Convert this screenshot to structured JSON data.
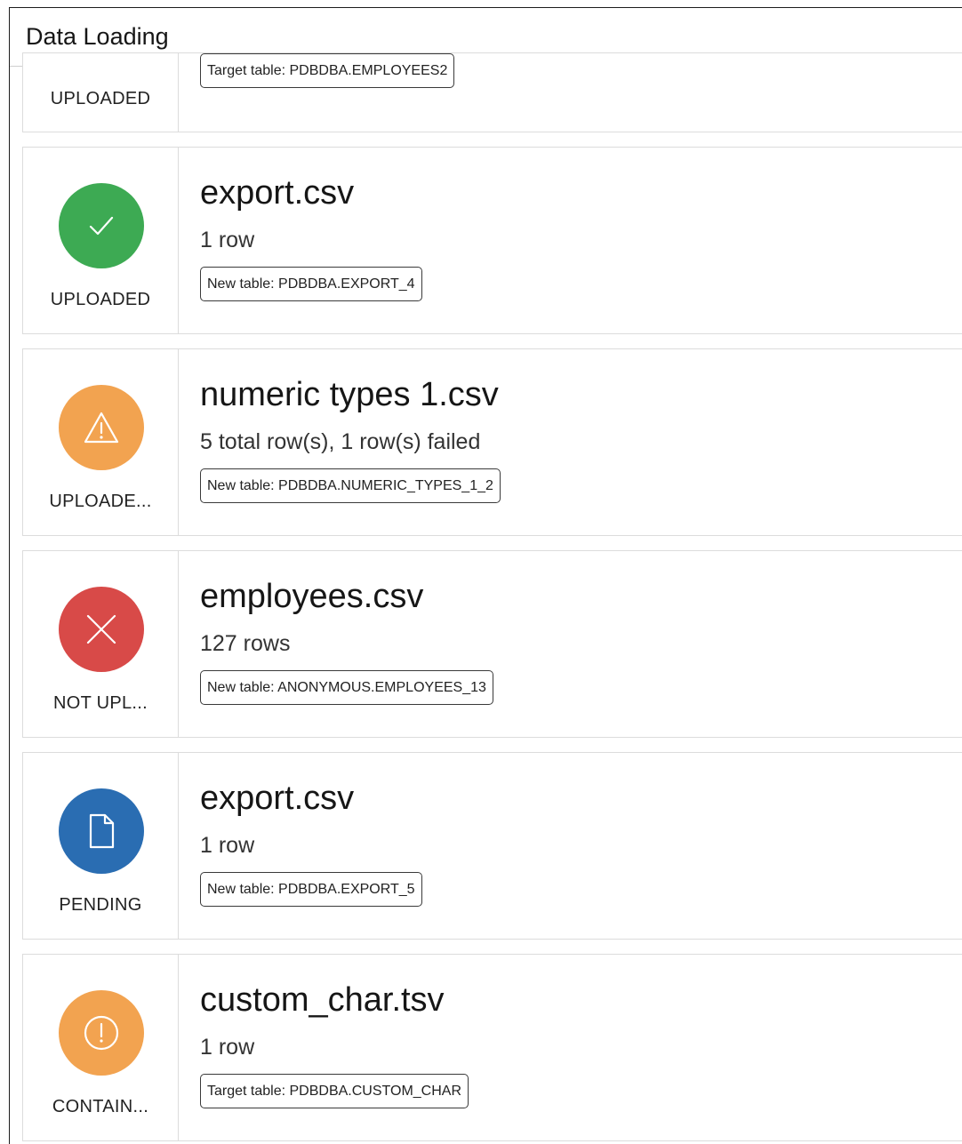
{
  "header": {
    "title": "Data Loading"
  },
  "items": [
    {
      "status": "UPLOADED",
      "target": "Target table: PDBDBA.EMPLOYEES2",
      "icon": "none",
      "color": "#ffffff"
    },
    {
      "status": "UPLOADED",
      "file": "export.csv",
      "rows": "1 row",
      "target": "New table: PDBDBA.EXPORT_4",
      "icon": "checkmark-icon",
      "color": "#3daa53"
    },
    {
      "status": "UPLOADE...",
      "file": "numeric types 1.csv",
      "rows": "5 total row(s), 1 row(s) failed",
      "target": "New table: PDBDBA.NUMERIC_TYPES_1_2",
      "icon": "warning-triangle-icon",
      "color": "#f2a350"
    },
    {
      "status": "NOT UPL...",
      "file": "employees.csv",
      "rows": "127 rows",
      "target": "New table: ANONYMOUS.EMPLOYEES_13",
      "icon": "close-icon",
      "color": "#d84a48"
    },
    {
      "status": "PENDING",
      "file": "export.csv",
      "rows": "1 row",
      "target": "New table: PDBDBA.EXPORT_5",
      "icon": "document-icon",
      "color": "#2a6db2"
    },
    {
      "status": "CONTAIN...",
      "file": "custom_char.tsv",
      "rows": "1 row",
      "target": "Target table: PDBDBA.CUSTOM_CHAR",
      "icon": "exclamation-circle-icon",
      "color": "#f2a350"
    }
  ]
}
